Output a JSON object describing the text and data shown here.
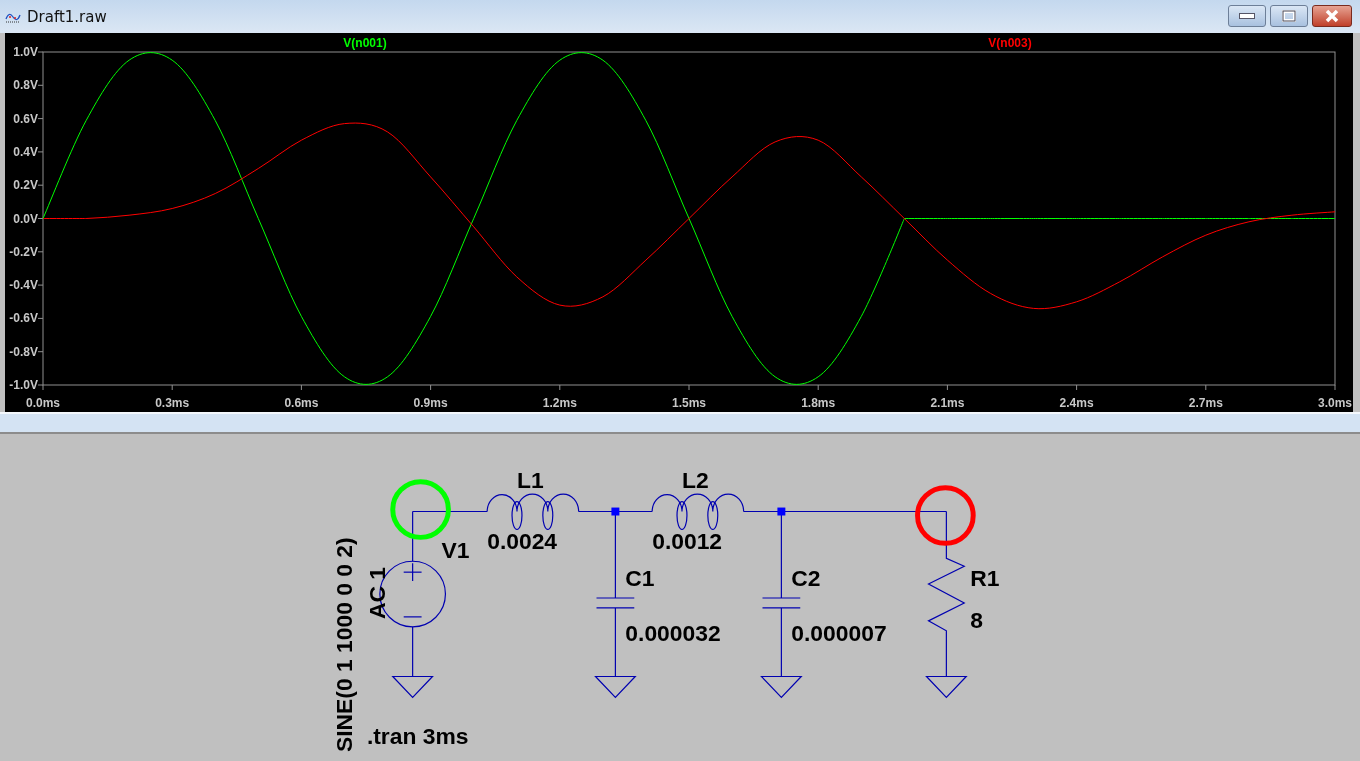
{
  "window": {
    "title": "Draft1.raw"
  },
  "plot": {
    "chart_data": {
      "type": "line",
      "x": [
        0,
        0.1,
        0.2,
        0.3,
        0.4,
        0.5,
        0.6,
        0.7,
        0.8,
        0.9,
        1.0,
        1.1,
        1.2,
        1.3,
        1.4,
        1.5,
        1.6,
        1.7,
        1.8,
        1.9,
        2.0,
        2.1,
        2.2,
        2.3,
        2.4,
        2.5,
        2.6,
        2.7,
        2.8,
        2.9,
        3.0
      ],
      "series": [
        {
          "name": "V(n001)",
          "color": "#00ff00",
          "values": [
            0,
            0.588,
            0.951,
            0.951,
            0.588,
            0,
            -0.588,
            -0.951,
            -0.951,
            -0.588,
            0,
            0.588,
            0.951,
            0.951,
            0.588,
            0,
            -0.588,
            -0.951,
            -0.951,
            -0.588,
            0,
            0,
            0,
            0,
            0,
            0,
            0,
            0,
            0,
            0,
            0
          ]
        },
        {
          "name": "V(n003)",
          "color": "#ff0000",
          "values": [
            0,
            0.0,
            0.02,
            0.06,
            0.15,
            0.3,
            0.47,
            0.57,
            0.52,
            0.25,
            -0.05,
            -0.35,
            -0.52,
            -0.47,
            -0.25,
            0.0,
            0.25,
            0.46,
            0.47,
            0.25,
            0.0,
            -0.25,
            -0.45,
            -0.54,
            -0.5,
            -0.38,
            -0.23,
            -0.1,
            -0.02,
            0.02,
            0.04
          ]
        }
      ],
      "xlim": [
        0,
        3
      ],
      "ylim": [
        -1,
        1
      ],
      "xticks": [
        {
          "value": 0,
          "label": "0.0ms"
        },
        {
          "value": 0.3,
          "label": "0.3ms"
        },
        {
          "value": 0.6,
          "label": "0.6ms"
        },
        {
          "value": 0.9,
          "label": "0.9ms"
        },
        {
          "value": 1.2,
          "label": "1.2ms"
        },
        {
          "value": 1.5,
          "label": "1.5ms"
        },
        {
          "value": 1.8,
          "label": "1.8ms"
        },
        {
          "value": 2.1,
          "label": "2.1ms"
        },
        {
          "value": 2.4,
          "label": "2.4ms"
        },
        {
          "value": 2.7,
          "label": "2.7ms"
        },
        {
          "value": 3.0,
          "label": "3.0ms"
        }
      ],
      "yticks": [
        {
          "value": 1,
          "label": "1.0V"
        },
        {
          "value": 0.8,
          "label": "0.8V"
        },
        {
          "value": 0.6,
          "label": "0.6V"
        },
        {
          "value": 0.4,
          "label": "0.4V"
        },
        {
          "value": 0.2,
          "label": "0.2V"
        },
        {
          "value": 0,
          "label": "0.0V"
        },
        {
          "value": -0.2,
          "label": "-0.2V"
        },
        {
          "value": -0.4,
          "label": "-0.4V"
        },
        {
          "value": -0.6,
          "label": "-0.6V"
        },
        {
          "value": -0.8,
          "label": "-0.8V"
        },
        {
          "value": -1,
          "label": "-1.0V"
        }
      ]
    }
  },
  "schematic": {
    "components": [
      {
        "kind": "voltage_source",
        "name": "V1",
        "value": "AC 1",
        "spec": "SINE(0 1 1000 0 0 2)"
      },
      {
        "kind": "inductor",
        "name": "L1",
        "value": "0.0024"
      },
      {
        "kind": "inductor",
        "name": "L2",
        "value": "0.0012"
      },
      {
        "kind": "capacitor",
        "name": "C1",
        "value": "0.000032"
      },
      {
        "kind": "capacitor",
        "name": "C2",
        "value": "0.000007"
      },
      {
        "kind": "resistor",
        "name": "R1",
        "value": "8"
      }
    ],
    "directive": ".tran 3ms",
    "probes": [
      {
        "color": "#00ff00"
      },
      {
        "color": "#ff0000"
      }
    ]
  }
}
